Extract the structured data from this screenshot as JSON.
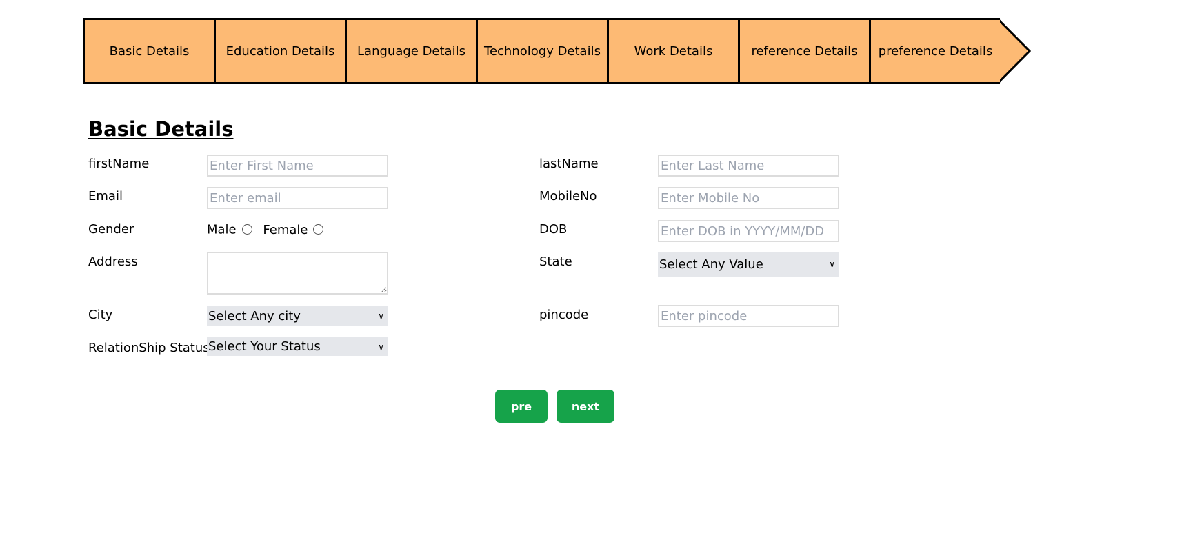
{
  "steps": [
    {
      "label": "Basic Details"
    },
    {
      "label": "Education Details"
    },
    {
      "label": "Language Details"
    },
    {
      "label": "Technology Details"
    },
    {
      "label": "Work Details"
    },
    {
      "label": "reference Details"
    },
    {
      "label": "preference Details"
    }
  ],
  "colors": {
    "step_bg": "#fdba74",
    "button_bg": "#16a34a",
    "select_bg": "#e5e7eb"
  },
  "form": {
    "title": "Basic Details",
    "firstName": {
      "label": "firstName",
      "placeholder": "Enter First Name"
    },
    "lastName": {
      "label": "lastName",
      "placeholder": "Enter Last Name"
    },
    "email": {
      "label": "Email",
      "placeholder": "Enter email"
    },
    "mobile": {
      "label": "MobileNo",
      "placeholder": "Enter Mobile No"
    },
    "gender": {
      "label": "Gender",
      "options": [
        "Male",
        "Female"
      ]
    },
    "dob": {
      "label": "DOB",
      "placeholder": "Enter DOB in YYYY/MM/DD"
    },
    "address": {
      "label": "Address"
    },
    "state": {
      "label": "State",
      "selected": "Select Any Value"
    },
    "city": {
      "label": "City",
      "selected": "Select Any city"
    },
    "pincode": {
      "label": "pincode",
      "placeholder": "Enter pincode"
    },
    "relationship": {
      "label": "RelationShip Status",
      "selected": "Select Your Status"
    }
  },
  "buttons": {
    "pre": "pre",
    "next": "next"
  }
}
